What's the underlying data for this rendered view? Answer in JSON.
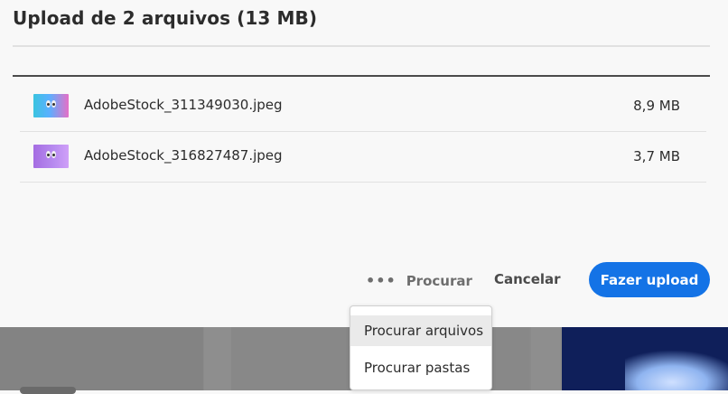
{
  "dialog": {
    "title": "Upload de 2 arquivos (13 MB)",
    "files": [
      {
        "name": "AdobeStock_311349030.jpeg",
        "size": "8,9 MB",
        "thumbnail": "blue-pink-gradient-eyes"
      },
      {
        "name": "AdobeStock_316827487.jpeg",
        "size": "3,7 MB",
        "thumbnail": "purple-gradient-eyes"
      }
    ],
    "actions": {
      "browse_label": "Procurar",
      "browse_icon": "more-dots-icon",
      "cancel_label": "Cancelar",
      "upload_label": "Fazer upload"
    },
    "colors": {
      "accent": "#1473e6"
    }
  },
  "browse_menu": {
    "items": [
      "Procurar arquivos",
      "Procurar pastas"
    ],
    "highlighted_index": 0
  }
}
